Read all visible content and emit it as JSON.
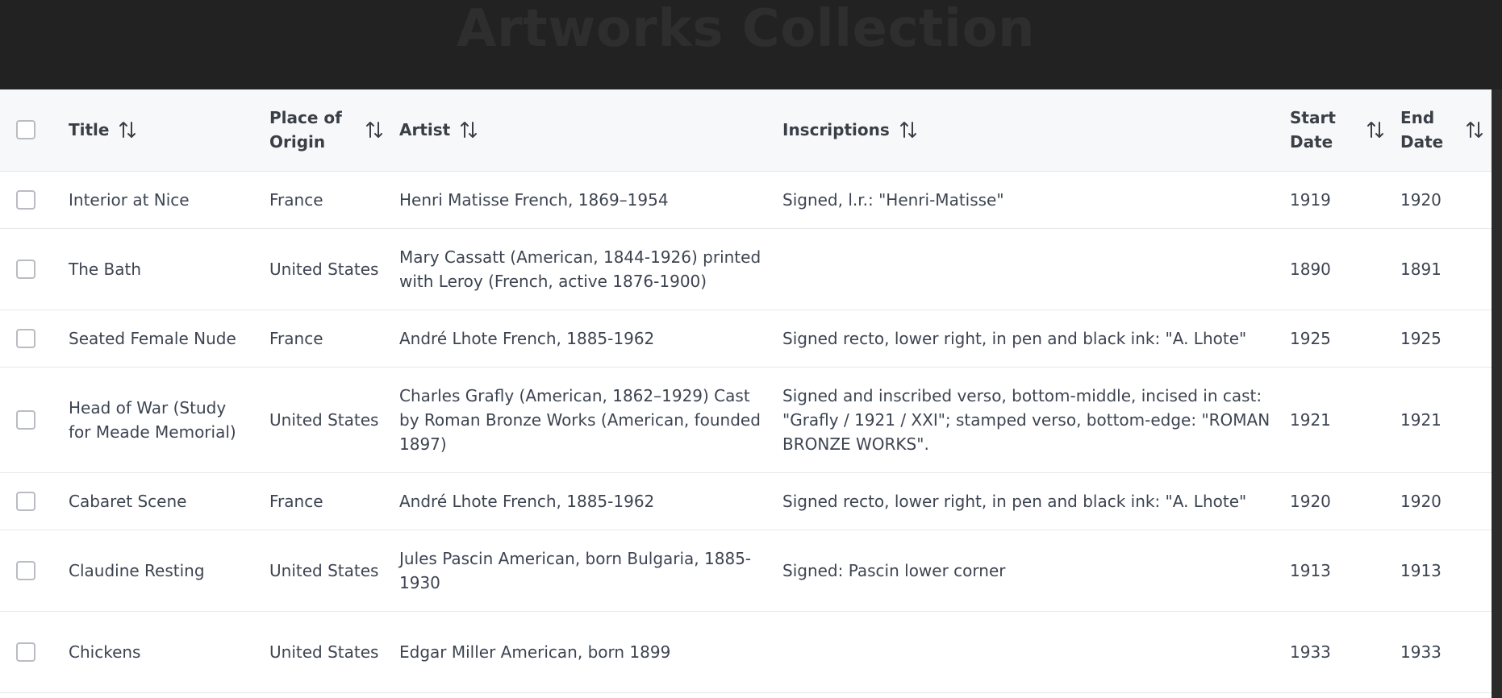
{
  "page": {
    "title": "Artworks Collection"
  },
  "table": {
    "columns": {
      "title": "Title",
      "origin": "Place of Origin",
      "artist": "Artist",
      "inscriptions": "Inscriptions",
      "start_date": "Start Date",
      "end_date": "End Date"
    },
    "rows": [
      {
        "title": "Interior at Nice",
        "origin": "France",
        "artist": "Henri Matisse French, 1869–1954",
        "inscriptions": "Signed, l.r.: \"Henri-Matisse\"",
        "start_date": "1919",
        "end_date": "1920"
      },
      {
        "title": "The Bath",
        "origin": "United States",
        "artist": "Mary Cassatt (American, 1844-1926) printed with Leroy (French, active 1876-1900)",
        "inscriptions": "",
        "start_date": "1890",
        "end_date": "1891"
      },
      {
        "title": "Seated Female Nude",
        "origin": "France",
        "artist": "André Lhote French, 1885-1962",
        "inscriptions": "Signed recto, lower right, in pen and black ink: \"A. Lhote\"",
        "start_date": "1925",
        "end_date": "1925"
      },
      {
        "title": "Head of War (Study for Meade Memorial)",
        "origin": "United States",
        "artist": "Charles Grafly (American, 1862–1929) Cast by Roman Bronze Works (American, founded 1897)",
        "inscriptions": "Signed and inscribed verso, bottom-middle, incised in cast: \"Grafly / 1921 / XXI\"; stamped verso, bottom-edge: \"ROMAN BRONZE WORKS\".",
        "start_date": "1921",
        "end_date": "1921"
      },
      {
        "title": "Cabaret Scene",
        "origin": "France",
        "artist": "André Lhote French, 1885-1962",
        "inscriptions": "Signed recto, lower right, in pen and black ink: \"A. Lhote\"",
        "start_date": "1920",
        "end_date": "1920"
      },
      {
        "title": "Claudine Resting",
        "origin": "United States",
        "artist": "Jules Pascin American, born Bulgaria, 1885-1930",
        "inscriptions": "Signed: Pascin lower corner",
        "start_date": "1913",
        "end_date": "1913"
      },
      {
        "title": "Chickens",
        "origin": "United States",
        "artist": "Edgar Miller American, born 1899",
        "inscriptions": "",
        "start_date": "1933",
        "end_date": "1933"
      }
    ]
  },
  "icons": {
    "sort": "sort-arrows-icon",
    "checkbox": "checkbox"
  },
  "colors": {
    "header_background": "#222222",
    "title_text": "#2e2e2e",
    "table_header_background": "#f7f8f9",
    "table_background": "#ffffff",
    "row_divider": "#e6e8eb",
    "cell_text": "#3d4451",
    "checkbox_border": "#b9bcc1"
  }
}
